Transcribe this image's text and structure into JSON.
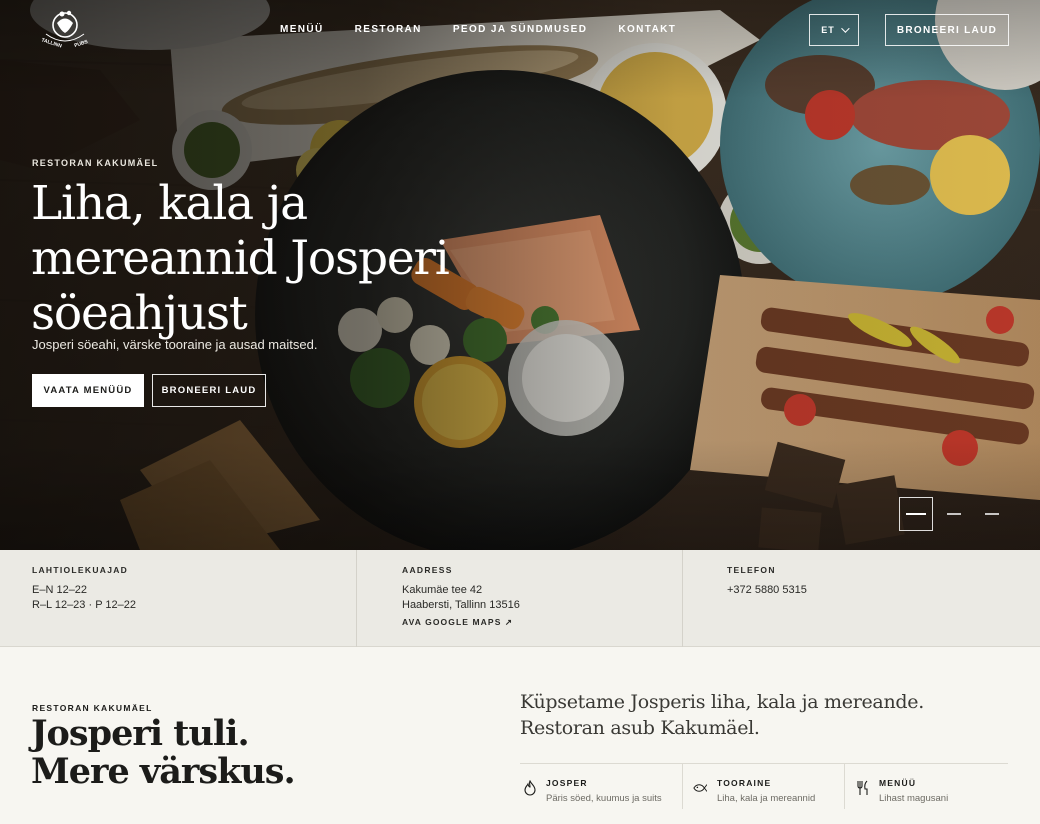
{
  "nav": {
    "logo_name": "tallinn-pubs-logo",
    "logo_text_left": "TALLINN",
    "logo_text_right": "PUBS",
    "items": [
      {
        "label": "MENÜÜ"
      },
      {
        "label": "RESTORAN"
      },
      {
        "label": "PEOD JA SÜNDMUSED"
      },
      {
        "label": "KONTAKT"
      }
    ],
    "lang": "ET",
    "book_label": "BRONEERI LAUD"
  },
  "hero": {
    "eyebrow": "RESTORAN KAKUMÄEL",
    "title": "Liha, kala ja mereannid Josperi söeahjust",
    "subtitle": "Josperi söeahi, värske tooraine ja ausad maitsed.",
    "primary_cta": "VAATA MENÜÜD",
    "secondary_cta": "BRONEERI LAUD",
    "slides": [
      {
        "active": true
      },
      {
        "active": false
      },
      {
        "active": false
      }
    ]
  },
  "info": {
    "hours": {
      "label": "LAHTIOLEKUAJAD",
      "line1": "E–N 12–22",
      "line2": "R–L 12–23 · P 12–22"
    },
    "address": {
      "label": "AADRESS",
      "line1": "Kakumäe tee 42",
      "line2": "Haabersti, Tallinn 13516",
      "link": "AVA GOOGLE MAPS ↗"
    },
    "phone": {
      "label": "TELEFON",
      "value": "+372 5880 5315"
    }
  },
  "about": {
    "eyebrow": "RESTORAN KAKUMÄEL",
    "title_line1": "Josperi tuli.",
    "title_line2": "Mere värskus.",
    "lead": "Küpsetame Josperis liha, kala ja mereande. Restoran asub Kakumäel.",
    "features": [
      {
        "icon": "flame-icon",
        "title": "JOSPER",
        "subtitle": "Päris söed, kuumus ja suits"
      },
      {
        "icon": "fish-icon",
        "title": "TOORAINE",
        "subtitle": "Liha, kala ja mereannid"
      },
      {
        "icon": "cutlery-icon",
        "title": "MENÜÜ",
        "subtitle": "Lihast magusani"
      }
    ]
  },
  "colors": {
    "hero_overlay": "#0a0806",
    "info_bg": "#ebeae4",
    "page_bg": "#f7f6f1",
    "text": "#1c1c1a"
  }
}
